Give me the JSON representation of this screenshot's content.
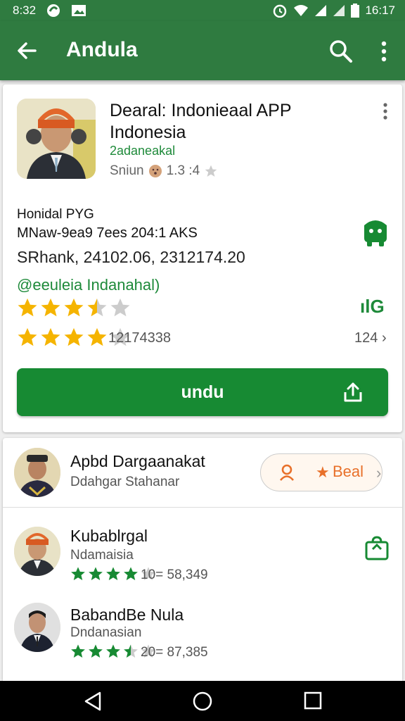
{
  "status_bar": {
    "time_left": "8:32",
    "time_right": "16:17"
  },
  "app_bar": {
    "title": "Andula",
    "back_icon": "arrow-back-icon",
    "search_icon": "search-icon",
    "more_icon": "more-vert-icon"
  },
  "app_card": {
    "name": "Dearal: Indonieaal APP Indonesia",
    "developer": "2adaneakal",
    "meta_prefix": "Sniun",
    "meta_rating": "1.3 :4",
    "info_line1": "Honidal PYG",
    "info_line2": "MNaw-9ea9 7ees 204:1 AKS",
    "info_line3": "SRhank, 24102.06, 2312174.20",
    "info_line4": "@eeuleia Indanahal)",
    "rating_stars_1": 3.5,
    "rating_stars_2": 4,
    "review_count": "12174338",
    "right_count": "124",
    "signal_text": "ılG",
    "install_label": "undu",
    "colors": {
      "primary": "#2f7b40",
      "button": "#178a33",
      "star": "#f5b400",
      "star_green": "#178a33",
      "accent": "#e8702a"
    }
  },
  "list": {
    "items": [
      {
        "title": "Apbd Dargaanakat",
        "subtitle": "Ddahgar Stahanar",
        "pill_text": "Beal"
      },
      {
        "title": "Kubablrgal",
        "subtitle": "Ndamaisia",
        "stars": 4,
        "count": "10= 58,349"
      },
      {
        "title": "BabandBe Nula",
        "subtitle": "Dndanasian",
        "stars": 3.5,
        "count": "20= 87,385"
      }
    ]
  }
}
